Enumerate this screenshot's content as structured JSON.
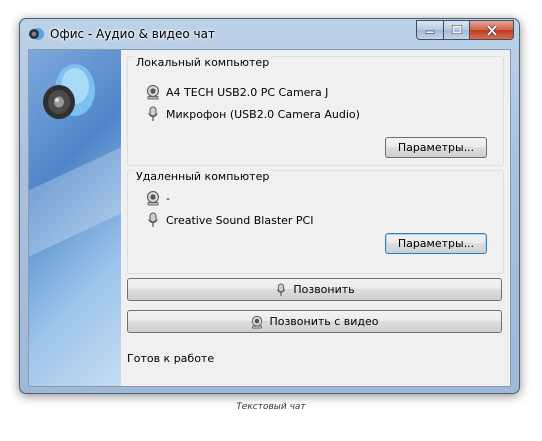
{
  "window": {
    "title": "Офис - Аудио & видео чат"
  },
  "local": {
    "group_title": "Локальный компьютер",
    "camera": "A4 TECH USB2.0 PC Camera J",
    "microphone": "Микрофон (USB2.0 Camera Audio)",
    "settings_button": "Параметры..."
  },
  "remote": {
    "group_title": "Удаленный компьютер",
    "camera": "-",
    "microphone": "Creative Sound Blaster PCI",
    "settings_button": "Параметры..."
  },
  "actions": {
    "call_label": "Позвонить",
    "video_call_label": "Позвонить с видео"
  },
  "status": "Готов к работе",
  "caption": "Текстовый чат",
  "colors": {
    "title_bar": "#a9c1dc",
    "close_button": "#c2391f",
    "sidebar": "#4f86c9",
    "focus_border": "#3c7fb1"
  }
}
